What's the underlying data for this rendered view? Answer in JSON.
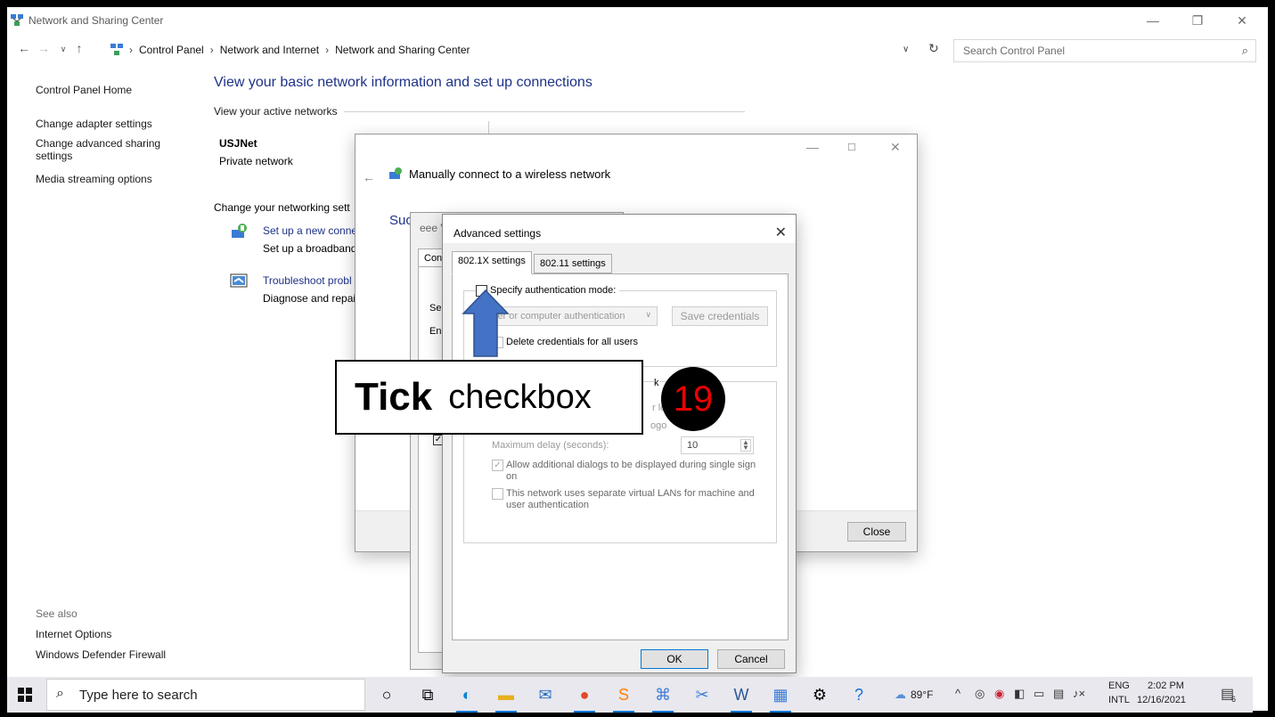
{
  "window": {
    "title": "Network and Sharing Center",
    "minimize": "—",
    "restore": "❐",
    "close": "✕"
  },
  "address": {
    "crumbs": [
      "Control Panel",
      "Network and Internet",
      "Network and Sharing Center"
    ],
    "search_placeholder": "Search Control Panel"
  },
  "left_pane": {
    "home": "Control Panel Home",
    "links": [
      "Change adapter settings",
      "Change advanced sharing settings",
      "Media streaming options"
    ],
    "see_also": "See also",
    "see_also_links": [
      "Internet Options",
      "Windows Defender Firewall"
    ]
  },
  "main": {
    "title": "View your basic network information and set up connections",
    "active_networks_header": "View your active networks",
    "network_name": "USJNet",
    "network_type": "Private network",
    "change_header": "Change your networking sett",
    "tasks": [
      {
        "link": "Set up a new conne",
        "desc": "Set up a broadband"
      },
      {
        "link": "Troubleshoot probl",
        "desc": "Diagnose and repai"
      }
    ]
  },
  "manual_dialog": {
    "title": "Manually connect to a wireless network",
    "success_text": "Suc",
    "close_button": "Close"
  },
  "props_dialog": {
    "title_fragment": "eee V",
    "tab_fragment": "Con",
    "row1": "Se",
    "row2": "En"
  },
  "advanced": {
    "title": "Advanced settings",
    "tabs": [
      "802.1X settings",
      "802.11 settings"
    ],
    "specify_auth": "Specify authentication mode:",
    "auth_mode": "User or computer authentication",
    "save_credentials": "Save credentials",
    "delete_credentials": "Delete credentials for all users",
    "frag_k": "k",
    "frag_lo": "r lo",
    "frag_ogo": "ogo",
    "max_delay_label": "Maximum delay (seconds):",
    "max_delay_value": "10",
    "allow_dialogs": "Allow additional dialogs to be displayed during single sign on",
    "separate_vlans": "This network uses separate virtual LANs for machine and user authentication",
    "ok": "OK",
    "cancel": "Cancel"
  },
  "annotation": {
    "tick_word": "Tick",
    "tick_rest": "checkbox",
    "step": "19"
  },
  "taskbar": {
    "search_placeholder": "Type here to search",
    "weather": "89°F",
    "lang_top": "ENG",
    "lang_bottom": "INTL",
    "time": "2:02 PM",
    "date": "12/16/2021",
    "notifications": "6"
  },
  "colors": {
    "link_blue": "#1e3287",
    "accent": "#0078d7",
    "arrow_fill": "#4472c4",
    "badge_text": "#ee0000"
  }
}
